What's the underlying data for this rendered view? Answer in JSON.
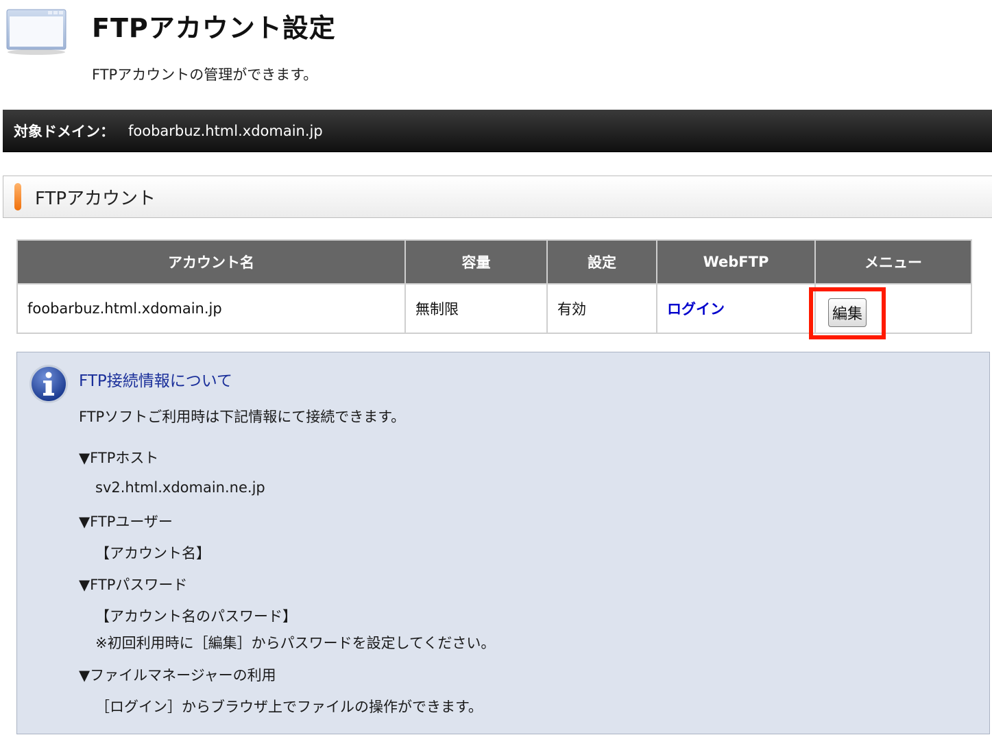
{
  "header": {
    "title": "FTPアカウント設定",
    "subtitle": "FTPアカウントの管理ができます。"
  },
  "domain_bar": {
    "label": "対象ドメイン：",
    "value": "foobarbuz.html.xdomain.jp"
  },
  "section": {
    "title": "FTPアカウント"
  },
  "table": {
    "headers": [
      "アカウント名",
      "容量",
      "設定",
      "WebFTP",
      "メニュー"
    ],
    "rows": [
      {
        "account": "foobarbuz.html.xdomain.jp",
        "capacity": "無制限",
        "setting": "有効",
        "webftp": "ログイン",
        "menu_button": "編集"
      }
    ]
  },
  "info": {
    "heading": "FTP接続情報について",
    "description": "FTPソフトご利用時は下記情報にて接続できます。",
    "host_label": "▼FTPホスト",
    "host_value": "sv2.html.xdomain.ne.jp",
    "user_label": "▼FTPユーザー",
    "user_value": "【アカウント名】",
    "password_label": "▼FTPパスワード",
    "password_value": "【アカウント名のパスワード】",
    "password_note": "※初回利用時に［編集］からパスワードを設定してください。",
    "filemanager_label": "▼ファイルマネージャーの利用",
    "filemanager_value": "［ログイン］からブラウザ上でファイルの操作ができます。"
  },
  "colors": {
    "highlight": "#ff1a00",
    "link": "#0000cc",
    "info_bg": "#dde3ee",
    "accent": "#f0700a"
  },
  "icons": {
    "page": "browser-window-icon",
    "info": "info-icon"
  }
}
